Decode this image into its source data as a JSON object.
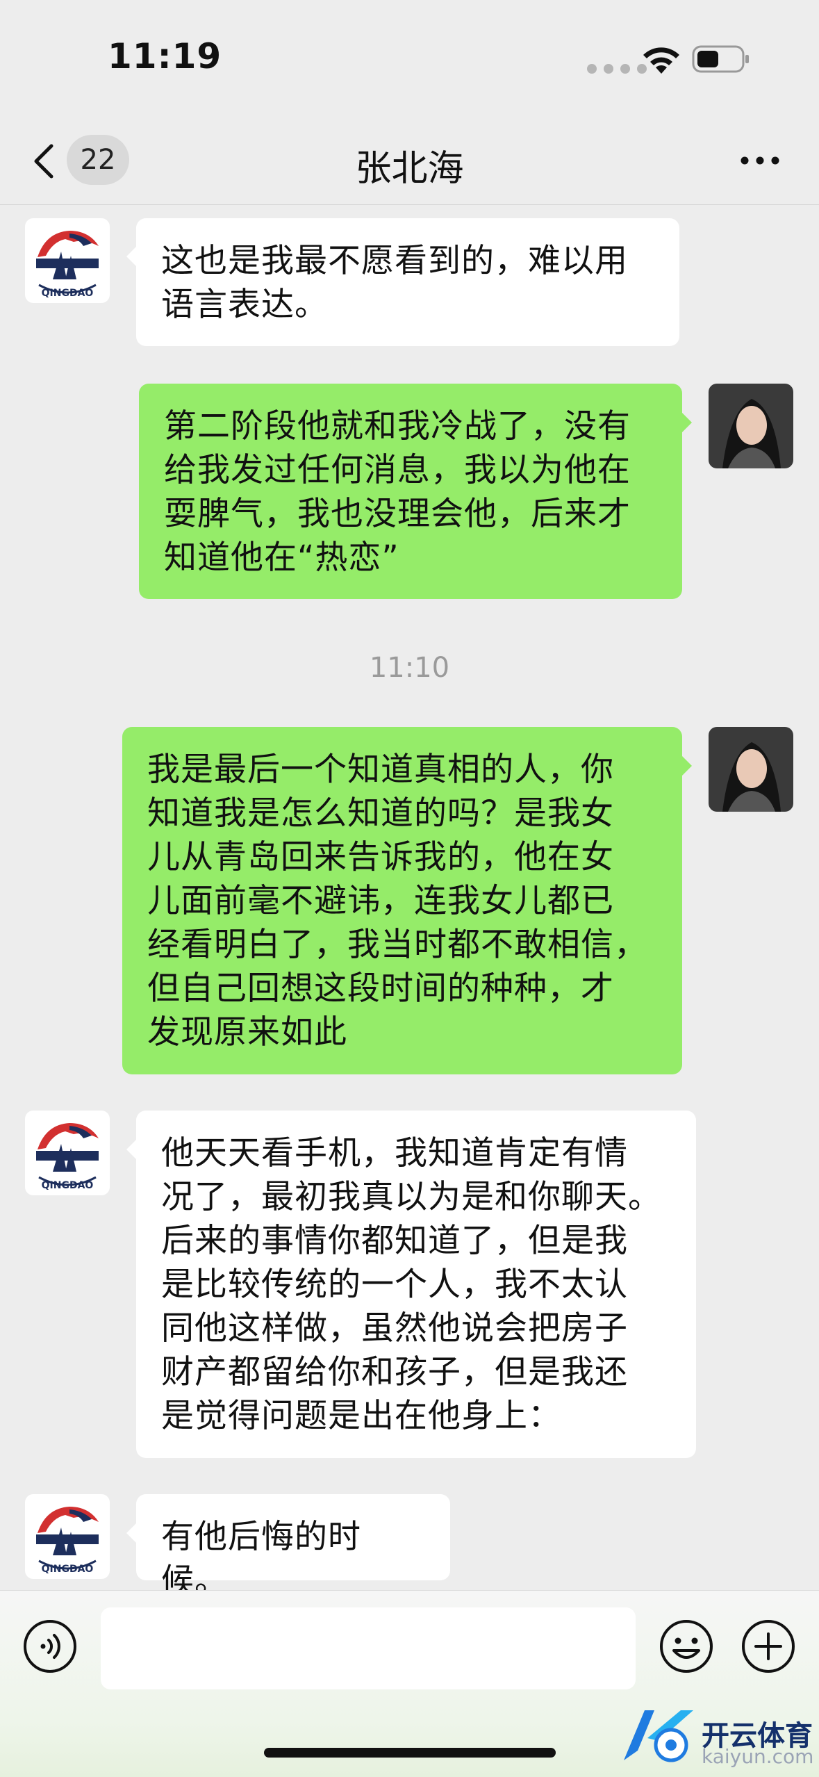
{
  "status_bar": {
    "time": "11:19"
  },
  "nav": {
    "unread_count": "22",
    "title": "张北海"
  },
  "messages": [
    {
      "side": "in",
      "text": "这也是我最不愿看到的，难以用\n语言表达。"
    },
    {
      "side": "out",
      "text": "第二阶段他就和我冷战了，没有\n给我发过任何消息，我以为他在\n耍脾气，我也没理会他，后来才\n知道他在“热恋”"
    },
    {
      "side": "out",
      "text": "我是最后一个知道真相的人，你\n知道我是怎么知道的吗？是我女\n儿从青岛回来告诉我的，他在女\n儿面前毫不避讳，连我女儿都已\n经看明白了，我当时都不敢相信，\n但自己回想这段时间的种种，才\n发现原来如此"
    },
    {
      "side": "in",
      "text": "他天天看手机，我知道肯定有情\n况了，最初我真以为是和你聊天。\n后来的事情你都知道了，但是我\n是比较传统的一个人，我不太认\n同他这样做，虽然他说会把房子\n财产都留给你和孩子，但是我还\n是觉得问题是出在他身上："
    },
    {
      "side": "in",
      "text": "有他后悔的时候。"
    }
  ],
  "timestamp": "11:10",
  "avatar_logo_text": "QINGDAO",
  "watermark": {
    "brand": "开云体育",
    "url": "kaiyun.com"
  },
  "icons": {
    "back": "chevron-left-icon",
    "more": "ellipsis-icon",
    "voice": "voice-icon",
    "emoji": "emoji-icon",
    "plus": "plus-icon",
    "wifi": "wifi-icon",
    "battery": "battery-icon"
  },
  "colors": {
    "incoming_bubble": "#ffffff",
    "outgoing_bubble": "#95ec69",
    "background": "#ededed"
  }
}
